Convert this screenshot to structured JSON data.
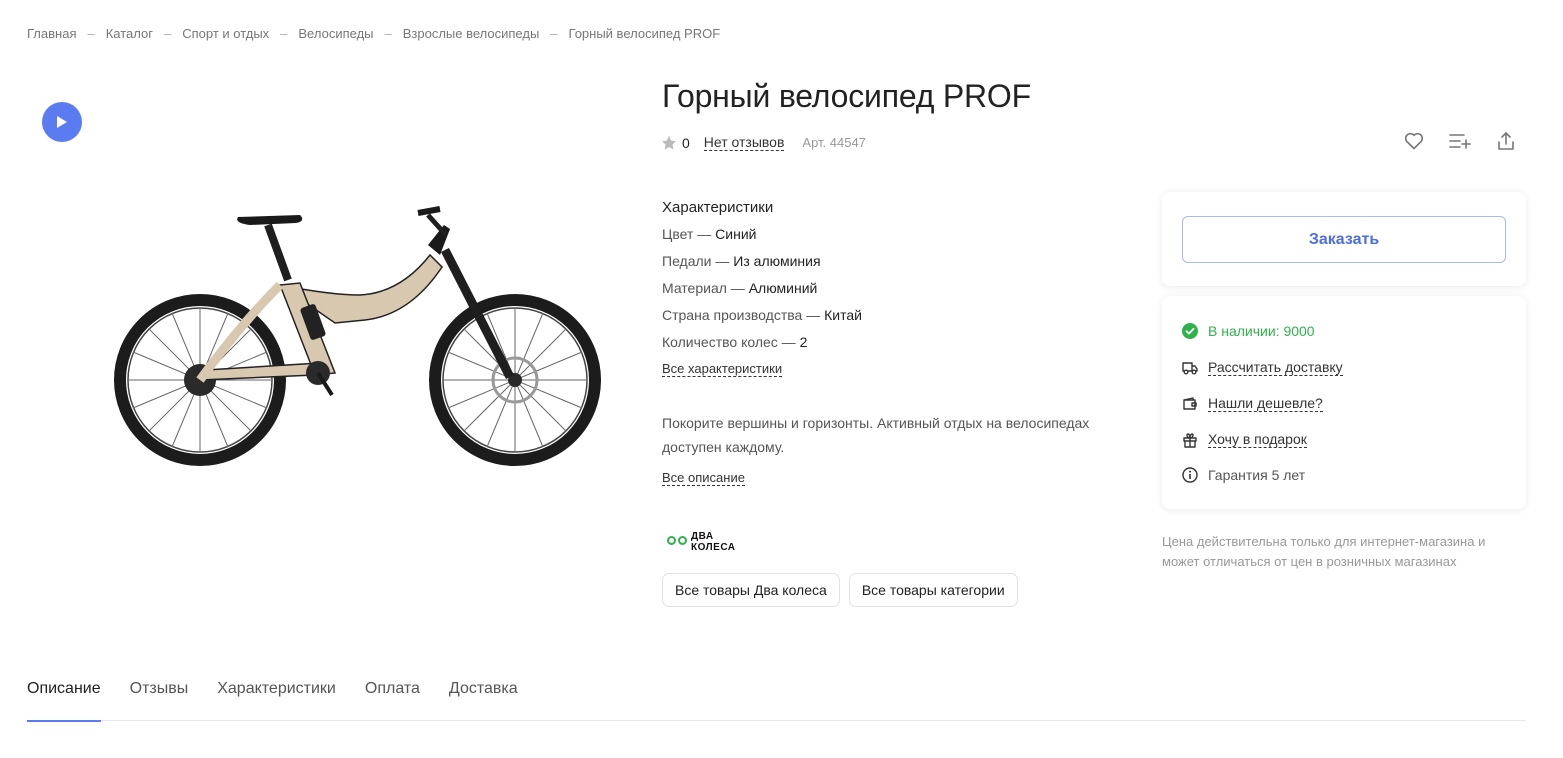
{
  "breadcrumb": [
    "Главная",
    "Каталог",
    "Спорт и отдых",
    "Велосипеды",
    "Взрослые велосипеды",
    "Горный велосипед PROF"
  ],
  "breadcrumb_separator": "–",
  "product": {
    "title": "Горный велосипед PROF",
    "rating": "0",
    "reviews_label": "Нет отзывов",
    "article": "Арт. 44547"
  },
  "specs": {
    "title": "Характеристики",
    "items": [
      {
        "name": "Цвет",
        "value": "Синий"
      },
      {
        "name": "Педали",
        "value": "Из алюминия"
      },
      {
        "name": "Материал",
        "value": "Алюминий"
      },
      {
        "name": "Страна производства",
        "value": "Китай"
      },
      {
        "name": "Количество колес",
        "value": "2"
      }
    ],
    "all_link": "Все характеристики"
  },
  "description": {
    "text": "Покорите вершины и горизонты. Активный отдых на велосипедах доступен каждому.",
    "all_link": "Все описание"
  },
  "brand": {
    "line1": "ДВА",
    "line2": "КОЛЕСА",
    "all_products_button": "Все товары Два колеса",
    "category_button": "Все товары категории"
  },
  "order": {
    "button_label": "Заказать"
  },
  "info": {
    "stock": "В наличии: 9000",
    "delivery": "Рассчитать доставку",
    "cheaper": "Нашли дешевле?",
    "gift": "Хочу в подарок",
    "warranty": "Гарантия 5 лет"
  },
  "price_note": "Цена действительна только для интернет-магазина и может отличаться от цен в розничных магазинах",
  "tabs": [
    "Описание",
    "Отзывы",
    "Характеристики",
    "Оплата",
    "Доставка"
  ],
  "active_tab": "Описание",
  "colors": {
    "accent": "#5b7bf0",
    "order_text": "#4e6de6",
    "in_stock": "#2fb24a",
    "bike_frame": "#d8c8b0"
  },
  "icons": [
    "play-icon",
    "star-icon",
    "heart-icon",
    "compare-list-icon",
    "share-icon",
    "check-circle-icon",
    "truck-icon",
    "wallet-icon",
    "gift-icon",
    "info-icon"
  ]
}
